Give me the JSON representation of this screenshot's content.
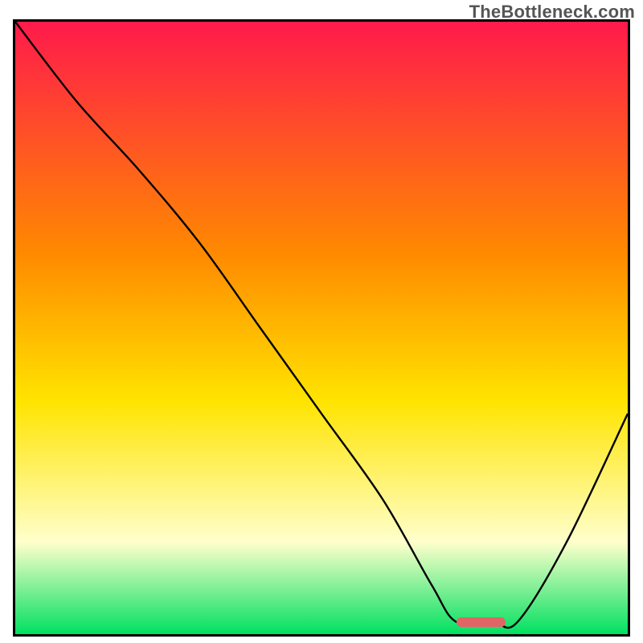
{
  "watermark": "TheBottleneck.com",
  "colors": {
    "top": "#ff1a4b",
    "mid1": "#ff8a00",
    "mid2": "#ffe400",
    "pale": "#ffffcc",
    "bottom": "#00e060",
    "curve": "#000000",
    "marker": "#e06666",
    "border": "#000000"
  },
  "chart_data": {
    "type": "line",
    "title": "",
    "xlabel": "",
    "ylabel": "",
    "xlim": [
      0,
      100
    ],
    "ylim": [
      0,
      100
    ],
    "grid": false,
    "legend": false,
    "series": [
      {
        "name": "bottleneck-curve",
        "x": [
          0,
          10,
          20,
          30,
          40,
          50,
          60,
          68,
          72,
          78,
          82,
          90,
          100
        ],
        "y": [
          100,
          87,
          76,
          64,
          50,
          36,
          22,
          8,
          2,
          2,
          2,
          15,
          36
        ]
      }
    ],
    "marker": {
      "x_start": 72,
      "x_end": 80,
      "y": 2
    },
    "gradient_stops": [
      {
        "pct": 0,
        "color": "#ff1a4b"
      },
      {
        "pct": 38,
        "color": "#ff8a00"
      },
      {
        "pct": 62,
        "color": "#ffe400"
      },
      {
        "pct": 85,
        "color": "#ffffcc"
      },
      {
        "pct": 100,
        "color": "#00e060"
      }
    ]
  }
}
